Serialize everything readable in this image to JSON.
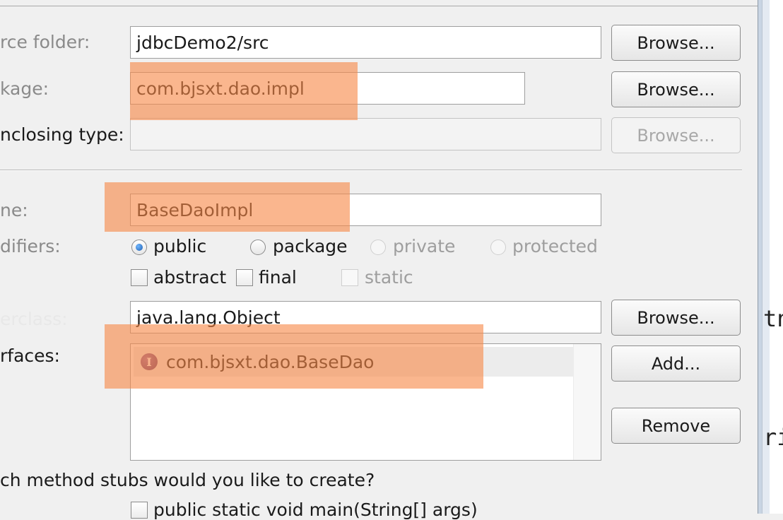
{
  "form": {
    "source_folder": {
      "label": "rce folder:",
      "value": "jdbcDemo2/src",
      "browse": "Browse..."
    },
    "package": {
      "label": "kage:",
      "value": "com.bjsxt.dao.impl",
      "browse": "Browse..."
    },
    "enclosing_type": {
      "label": "nclosing type:",
      "value": "",
      "browse": "Browse..."
    },
    "name": {
      "label": "ne:",
      "value": "BaseDaoImpl"
    },
    "modifiers": {
      "label": "difiers:",
      "access": [
        "public",
        "package",
        "private",
        "protected"
      ],
      "selected": "public",
      "flags": [
        "abstract",
        "final",
        "static"
      ]
    },
    "superclass": {
      "label": "erclass:",
      "value": "java.lang.Object",
      "browse": "Browse..."
    },
    "interfaces": {
      "label": "rfaces:",
      "items": [
        "com.bjsxt.dao.BaseDao"
      ],
      "add": "Add...",
      "remove": "Remove"
    },
    "stubs_question": "ch method stubs would you like to create?",
    "stub_main": "public static void main(String[] args)"
  },
  "editor_fragments": [
    "tn",
    "ri"
  ],
  "colors": {
    "highlight": "#f78948",
    "interface_icon": "#6b3f73",
    "radio_selected": "#1f5fb0"
  }
}
